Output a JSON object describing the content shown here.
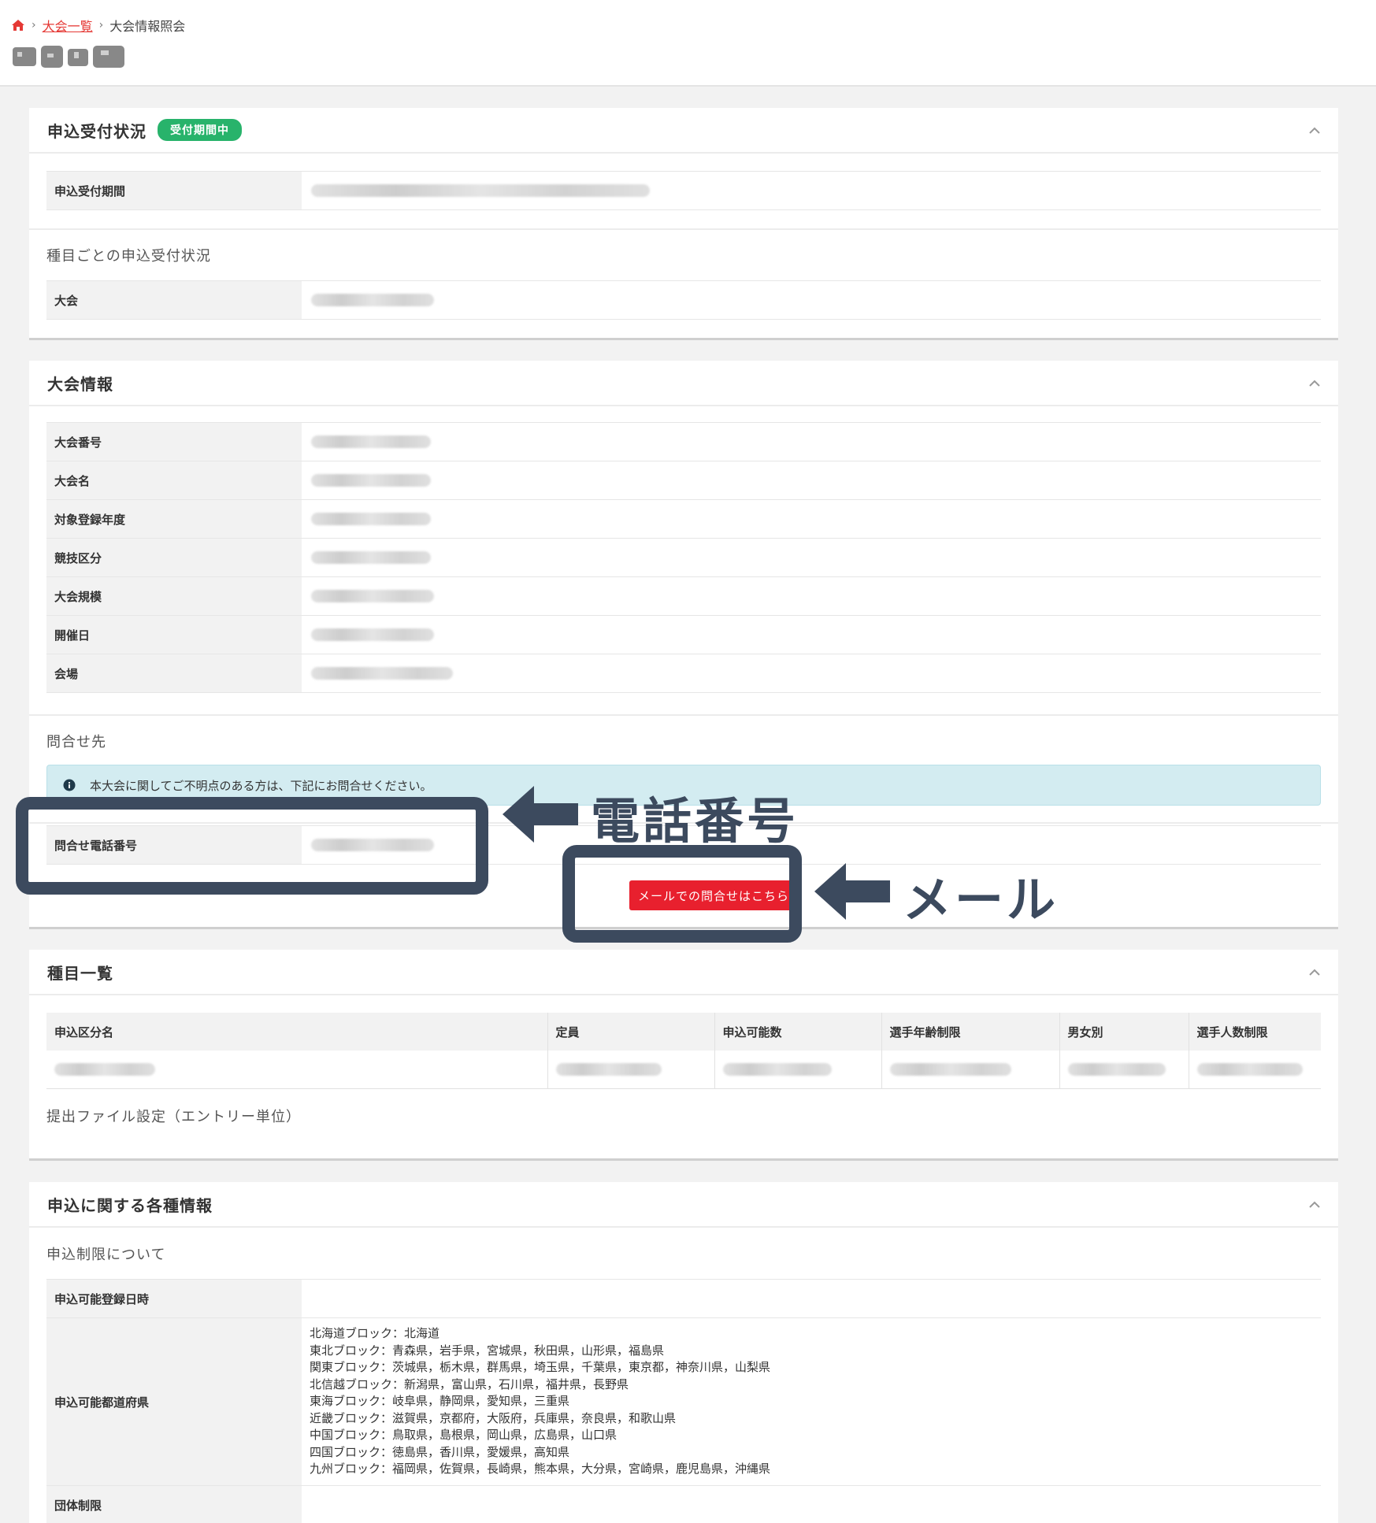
{
  "breadcrumb": {
    "link": "大会一覧",
    "current": "大会情報照会"
  },
  "status_card": {
    "title": "申込受付状況",
    "badge": "受付期間中",
    "period_label": "申込受付期間",
    "by_event_label": "種目ごとの申込受付状況",
    "event_label": "大会"
  },
  "info_card": {
    "title": "大会情報",
    "rows": [
      "大会番号",
      "大会名",
      "対象登録年度",
      "競技区分",
      "大会規模",
      "開催日",
      "会場"
    ],
    "contact_label": "問合せ先",
    "alert": "本大会に関してご不明点のある方は、下記にお問合せください。",
    "phone_label": "問合せ電話番号",
    "mail_button": "メールでの問合せはこちら"
  },
  "annotations": {
    "phone": "電話番号",
    "mail": "メール"
  },
  "events_card": {
    "title": "種目一覧",
    "columns": [
      "申込区分名",
      "定員",
      "申込可能数",
      "選手年齢制限",
      "男女別",
      "選手人数制限"
    ],
    "file_setting_label": "提出ファイル設定（エントリー単位）"
  },
  "apply_card": {
    "title": "申込に関する各種情報",
    "restriction_label": "申込制限について",
    "rows": {
      "registration_date": "申込可能登録日時",
      "prefectures": "申込可能都道府県",
      "group_limit": "団体制限"
    },
    "prefecture_lines": [
      "北海道ブロック：北海道",
      "東北ブロック：青森県，岩手県，宮城県，秋田県，山形県，福島県",
      "関東ブロック：茨城県，栃木県，群馬県，埼玉県，千葉県，東京都，神奈川県，山梨県",
      "北信越ブロック：新潟県，富山県，石川県，福井県，長野県",
      "東海ブロック：岐阜県，静岡県，愛知県，三重県",
      "近畿ブロック：滋賀県，京都府，大阪府，兵庫県，奈良県，和歌山県",
      "中国ブロック：鳥取県，島根県，岡山県，広島県，山口県",
      "四国ブロック：徳島県，香川県，愛媛県，高知県",
      "九州ブロック：福岡県，佐賀県，長崎県，熊本県，大分県，宮崎県，鹿児島県，沖縄県"
    ]
  },
  "colors": {
    "accent_red": "#e8202e",
    "badge_green": "#28b36b",
    "annotation": "#3c4a5e",
    "alert_bg": "#d3ecf1"
  }
}
